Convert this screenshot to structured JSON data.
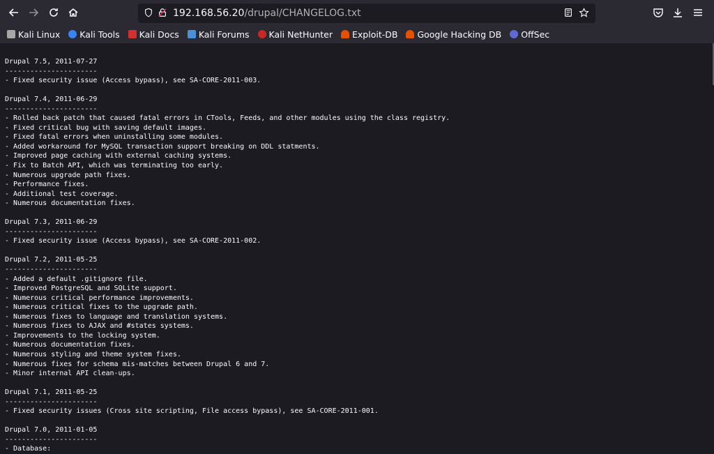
{
  "browser": {
    "url_host": "192.168.56.20",
    "url_path": "/drupal/CHANGELOG.txt"
  },
  "bookmarks": [
    {
      "label": "Kali Linux",
      "color": "#a7a7a7"
    },
    {
      "label": "Kali Tools",
      "color": "#3b82f6"
    },
    {
      "label": "Kali Docs",
      "color": "#d32f2f"
    },
    {
      "label": "Kali Forums",
      "color": "#4a90d9"
    },
    {
      "label": "Kali NetHunter",
      "color": "#c62828"
    },
    {
      "label": "Exploit-DB",
      "color": "#e65100"
    },
    {
      "label": "Google Hacking DB",
      "color": "#e65100"
    },
    {
      "label": "OffSec",
      "color": "#5e6ad2"
    }
  ],
  "changelog_lines": [
    "Drupal 7.5, 2011-07-27",
    "----------------------",
    "- Fixed security issue (Access bypass), see SA-CORE-2011-003.",
    "",
    "Drupal 7.4, 2011-06-29",
    "----------------------",
    "- Rolled back patch that caused fatal errors in CTools, Feeds, and other modules using the class registry.",
    "- Fixed critical bug with saving default images.",
    "- Fixed fatal errors when uninstalling some modules.",
    "- Added workaround for MySQL transaction support breaking on DDL statments.",
    "- Improved page caching with external caching systems.",
    "- Fix to Batch API, which was terminating too early.",
    "- Numerous upgrade path fixes.",
    "- Performance fixes.",
    "- Additional test coverage.",
    "- Numerous documentation fixes.",
    "",
    "Drupal 7.3, 2011-06-29",
    "----------------------",
    "- Fixed security issue (Access bypass), see SA-CORE-2011-002.",
    "",
    "Drupal 7.2, 2011-05-25",
    "----------------------",
    "- Added a default .gitignore file.",
    "- Improved PostgreSQL and SQLite support.",
    "- Numerous critical performance improvements.",
    "- Numerous critical fixes to the upgrade path.",
    "- Numerous fixes to language and translation systems.",
    "- Numerous fixes to AJAX and #states systems.",
    "- Improvements to the locking system.",
    "- Numerous documentation fixes.",
    "- Numerous styling and theme system fixes.",
    "- Numerous fixes for schema mis-matches between Drupal 6 and 7.",
    "- Minor internal API clean-ups.",
    "",
    "Drupal 7.1, 2011-05-25",
    "----------------------",
    "- Fixed security issues (Cross site scripting, File access bypass), see SA-CORE-2011-001.",
    "",
    "Drupal 7.0, 2011-01-05",
    "----------------------",
    "- Database:"
  ]
}
